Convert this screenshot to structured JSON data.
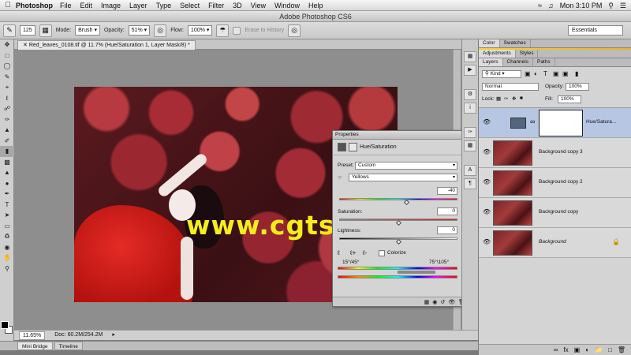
{
  "menubar": {
    "app_name": "Photoshop",
    "items": [
      "File",
      "Edit",
      "Image",
      "Layer",
      "Type",
      "Select",
      "Filter",
      "3D",
      "View",
      "Window",
      "Help"
    ],
    "clock": "Mon 3:10 PM"
  },
  "window": {
    "title": "Adobe Photoshop CS6"
  },
  "options": {
    "brush_size": "125",
    "mode_label": "Mode:",
    "mode_value": "Brush",
    "opacity_label": "Opacity:",
    "opacity_value": "51%",
    "flow_label": "Flow:",
    "flow_value": "100%",
    "erase_history": "Erase to History",
    "workspace": "Essentials"
  },
  "document": {
    "tab_title": "Red_leaves_0108.tif @ 11.7% (Hue/Saturation 1, Layer Mask/8) *",
    "watermark": "www.cgtsj.com"
  },
  "properties": {
    "panel_title": "Properties",
    "adjustment_name": "Hue/Saturation",
    "preset_label": "Preset:",
    "preset_value": "Custom",
    "channel_value": "Yellows",
    "hue_value": "-40",
    "saturation_label": "Saturation:",
    "saturation_value": "0",
    "lightness_label": "Lightness:",
    "lightness_value": "0",
    "colorize_label": "Colorize",
    "range_left": "15°/45°",
    "range_right": "75°\\105°"
  },
  "status": {
    "zoom": "11.65%",
    "doc_info": "Doc: 60.2M/254.2M"
  },
  "bottom_tabs": [
    "Mini Bridge",
    "Timeline"
  ],
  "panels": {
    "top_tabs": [
      "Color",
      "Swatches"
    ],
    "mid_tabs": [
      "Adjustments",
      "Styles"
    ],
    "layer_tabs": [
      "Layers",
      "Channels",
      "Paths"
    ],
    "kind_filter": "Kind",
    "blend_mode": "Normal",
    "opacity_label": "Opacity:",
    "opacity_value": "100%",
    "lock_label": "Lock:",
    "fill_label": "Fill:",
    "fill_value": "100%"
  },
  "layers": [
    {
      "name": "Hue/Satura...",
      "selected": true,
      "type": "adjustment"
    },
    {
      "name": "Background copy 3",
      "selected": false,
      "type": "pixel"
    },
    {
      "name": "Background copy 2",
      "selected": false,
      "type": "pixel"
    },
    {
      "name": "Background copy",
      "selected": false,
      "type": "pixel"
    },
    {
      "name": "Background",
      "selected": false,
      "type": "pixel",
      "locked": true
    }
  ],
  "colors": {
    "selected_layer": "#b7c6e3",
    "watermark": "#f6ee1a",
    "swatch_strip": "#f3d236"
  }
}
